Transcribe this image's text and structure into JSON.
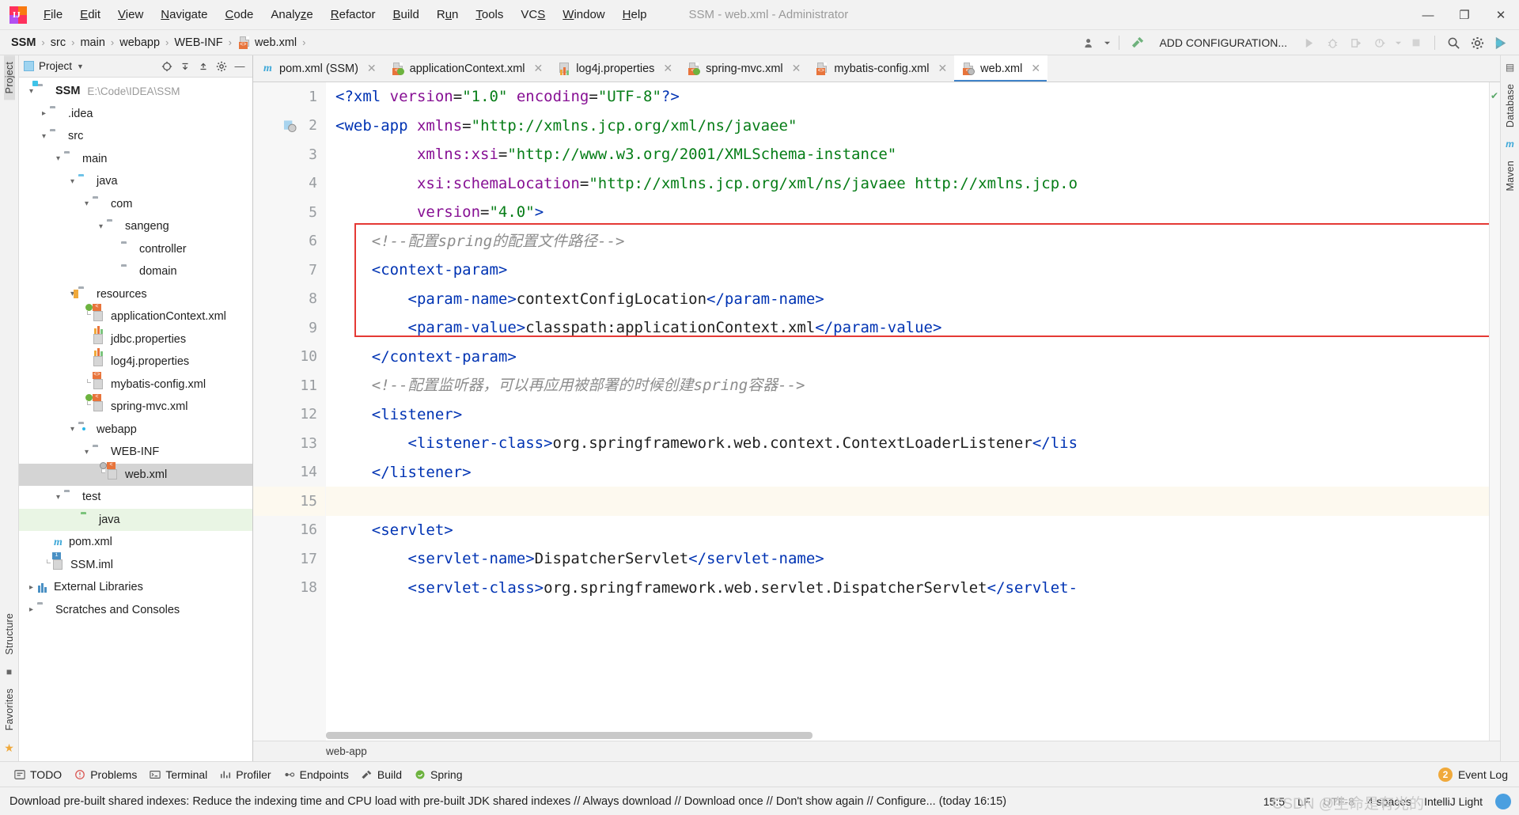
{
  "window": {
    "title": "SSM - web.xml - Administrator",
    "minimize": "—",
    "maximize": "❐",
    "close": "✕"
  },
  "menubar": {
    "items": [
      {
        "label": "File",
        "mnemonic": "F"
      },
      {
        "label": "Edit",
        "mnemonic": "E"
      },
      {
        "label": "View",
        "mnemonic": "V"
      },
      {
        "label": "Navigate",
        "mnemonic": "N"
      },
      {
        "label": "Code",
        "mnemonic": "C"
      },
      {
        "label": "Analyze",
        "mnemonic": "z"
      },
      {
        "label": "Refactor",
        "mnemonic": "R"
      },
      {
        "label": "Build",
        "mnemonic": "B"
      },
      {
        "label": "Run",
        "mnemonic": "u"
      },
      {
        "label": "Tools",
        "mnemonic": "T"
      },
      {
        "label": "VCS",
        "mnemonic": "S"
      },
      {
        "label": "Window",
        "mnemonic": "W"
      },
      {
        "label": "Help",
        "mnemonic": "H"
      }
    ]
  },
  "navbar": {
    "breadcrumbs": [
      "SSM",
      "src",
      "main",
      "webapp",
      "WEB-INF",
      "web.xml"
    ],
    "separator": "›",
    "add_configuration": "ADD CONFIGURATION...",
    "icons": [
      "account-icon",
      "chevron-down-icon",
      "build-hammer-icon",
      "run-icon",
      "debug-icon",
      "coverage-icon",
      "profile-icon",
      "chevron-down-icon",
      "stop-icon",
      "search-icon",
      "gear-icon",
      "ide-assistant-icon"
    ]
  },
  "left_rail": {
    "items": [
      "Project",
      "Structure",
      "Favorites"
    ]
  },
  "right_rail": {
    "items": [
      "Database",
      "Maven"
    ]
  },
  "project_panel": {
    "title": "Project",
    "actions": [
      "locate-icon",
      "collapse-all-icon",
      "expand-all-icon",
      "settings-icon",
      "hide-icon"
    ],
    "tree": [
      {
        "label": "SSM",
        "path": "E:\\Code\\IDEA\\SSM",
        "indent": 0,
        "arrow": "v",
        "icon": "module-folder",
        "bold": true,
        "state": "normal"
      },
      {
        "label": ".idea",
        "path": "",
        "indent": 1,
        "arrow": ">",
        "icon": "folder",
        "bold": false,
        "state": "normal"
      },
      {
        "label": "src",
        "path": "",
        "indent": 1,
        "arrow": "v",
        "icon": "folder",
        "bold": false,
        "state": "normal"
      },
      {
        "label": "main",
        "path": "",
        "indent": 2,
        "arrow": "v",
        "icon": "folder",
        "bold": false,
        "state": "normal"
      },
      {
        "label": "java",
        "path": "",
        "indent": 3,
        "arrow": "v",
        "icon": "source-folder",
        "bold": false,
        "state": "normal"
      },
      {
        "label": "com",
        "path": "",
        "indent": 4,
        "arrow": "v",
        "icon": "package",
        "bold": false,
        "state": "normal"
      },
      {
        "label": "sangeng",
        "path": "",
        "indent": 5,
        "arrow": "v",
        "icon": "package",
        "bold": false,
        "state": "normal"
      },
      {
        "label": "controller",
        "path": "",
        "indent": 6,
        "arrow": "",
        "icon": "package",
        "bold": false,
        "state": "normal"
      },
      {
        "label": "domain",
        "path": "",
        "indent": 6,
        "arrow": "",
        "icon": "package",
        "bold": false,
        "state": "normal"
      },
      {
        "label": "resources",
        "path": "",
        "indent": 3,
        "arrow": "v",
        "icon": "resource-folder",
        "bold": false,
        "state": "normal"
      },
      {
        "label": "applicationContext.xml",
        "path": "",
        "indent": 4,
        "arrow": "",
        "icon": "spring-xml",
        "bold": false,
        "state": "normal"
      },
      {
        "label": "jdbc.properties",
        "path": "",
        "indent": 4,
        "arrow": "",
        "icon": "properties",
        "bold": false,
        "state": "normal"
      },
      {
        "label": "log4j.properties",
        "path": "",
        "indent": 4,
        "arrow": "",
        "icon": "properties",
        "bold": false,
        "state": "normal"
      },
      {
        "label": "mybatis-config.xml",
        "path": "",
        "indent": 4,
        "arrow": "",
        "icon": "xml",
        "bold": false,
        "state": "normal"
      },
      {
        "label": "spring-mvc.xml",
        "path": "",
        "indent": 4,
        "arrow": "",
        "icon": "spring-xml",
        "bold": false,
        "state": "normal"
      },
      {
        "label": "webapp",
        "path": "",
        "indent": 3,
        "arrow": "v",
        "icon": "web-folder",
        "bold": false,
        "state": "normal"
      },
      {
        "label": "WEB-INF",
        "path": "",
        "indent": 4,
        "arrow": "v",
        "icon": "folder",
        "bold": false,
        "state": "normal"
      },
      {
        "label": "web.xml",
        "path": "",
        "indent": 5,
        "arrow": "",
        "icon": "web-xml",
        "bold": false,
        "state": "selected"
      },
      {
        "label": "test",
        "path": "",
        "indent": 2,
        "arrow": "v",
        "icon": "folder",
        "bold": false,
        "state": "normal"
      },
      {
        "label": "java",
        "path": "",
        "indent": 3,
        "arrow": "",
        "icon": "test-source-folder",
        "bold": false,
        "state": "highlighted"
      },
      {
        "label": "pom.xml",
        "path": "",
        "indent": 1,
        "arrow": "",
        "icon": "maven",
        "bold": false,
        "state": "normal"
      },
      {
        "label": "SSM.iml",
        "path": "",
        "indent": 1,
        "arrow": "",
        "icon": "iml",
        "bold": false,
        "state": "normal"
      },
      {
        "label": "External Libraries",
        "path": "",
        "indent": 0,
        "arrow": ">",
        "icon": "library",
        "bold": false,
        "state": "normal"
      },
      {
        "label": "Scratches and Consoles",
        "path": "",
        "indent": 0,
        "arrow": ">",
        "icon": "scratch",
        "bold": false,
        "state": "normal"
      }
    ]
  },
  "editor_tabs": [
    {
      "label": "pom.xml (SSM)",
      "icon": "maven-icon",
      "active": false,
      "close": "✕"
    },
    {
      "label": "applicationContext.xml",
      "icon": "spring-xml-icon",
      "active": false,
      "close": "✕"
    },
    {
      "label": "log4j.properties",
      "icon": "properties-icon",
      "active": false,
      "close": "✕"
    },
    {
      "label": "spring-mvc.xml",
      "icon": "spring-xml-icon",
      "active": false,
      "close": "✕"
    },
    {
      "label": "mybatis-config.xml",
      "icon": "xml-icon",
      "active": false,
      "close": "✕"
    },
    {
      "label": "web.xml",
      "icon": "web-xml-icon",
      "active": true,
      "close": "✕"
    }
  ],
  "editor": {
    "line_numbers": [
      "1",
      "2",
      "3",
      "4",
      "5",
      "6",
      "7",
      "8",
      "9",
      "10",
      "11",
      "12",
      "13",
      "14",
      "15",
      "16",
      "17",
      "18"
    ],
    "current_line": 15,
    "breadcrumb": "web-app",
    "lines": [
      {
        "n": 1,
        "tokens": [
          {
            "t": "<?",
            "c": "pi"
          },
          {
            "t": "xml",
            "c": "tag"
          },
          {
            "t": " ",
            "c": "txt"
          },
          {
            "t": "version",
            "c": "attr"
          },
          {
            "t": "=",
            "c": "txt"
          },
          {
            "t": "\"1.0\"",
            "c": "str"
          },
          {
            "t": " ",
            "c": "txt"
          },
          {
            "t": "encoding",
            "c": "attr"
          },
          {
            "t": "=",
            "c": "txt"
          },
          {
            "t": "\"UTF-8\"",
            "c": "str"
          },
          {
            "t": "?>",
            "c": "pi"
          }
        ]
      },
      {
        "n": 2,
        "tokens": [
          {
            "t": "<web-app",
            "c": "tag"
          },
          {
            "t": " ",
            "c": "txt"
          },
          {
            "t": "xmlns",
            "c": "attr"
          },
          {
            "t": "=",
            "c": "txt"
          },
          {
            "t": "\"http://xmlns.jcp.org/xml/ns/javaee\"",
            "c": "str"
          }
        ]
      },
      {
        "n": 3,
        "tokens": [
          {
            "t": "         ",
            "c": "txt"
          },
          {
            "t": "xmlns:xsi",
            "c": "attr"
          },
          {
            "t": "=",
            "c": "txt"
          },
          {
            "t": "\"http://www.w3.org/2001/XMLSchema-instance\"",
            "c": "str"
          }
        ]
      },
      {
        "n": 4,
        "tokens": [
          {
            "t": "         ",
            "c": "txt"
          },
          {
            "t": "xsi:schemaLocation",
            "c": "attr"
          },
          {
            "t": "=",
            "c": "txt"
          },
          {
            "t": "\"http://xmlns.jcp.org/xml/ns/javaee http://xmlns.jcp.o",
            "c": "str"
          }
        ]
      },
      {
        "n": 5,
        "tokens": [
          {
            "t": "         ",
            "c": "txt"
          },
          {
            "t": "version",
            "c": "attr"
          },
          {
            "t": "=",
            "c": "txt"
          },
          {
            "t": "\"4.0\"",
            "c": "str"
          },
          {
            "t": ">",
            "c": "tag"
          }
        ]
      },
      {
        "n": 6,
        "tokens": [
          {
            "t": "    <!--配置spring的配置文件路径-->",
            "c": "cmt"
          }
        ]
      },
      {
        "n": 7,
        "tokens": [
          {
            "t": "    ",
            "c": "txt"
          },
          {
            "t": "<context-param>",
            "c": "tag"
          }
        ]
      },
      {
        "n": 8,
        "tokens": [
          {
            "t": "        ",
            "c": "txt"
          },
          {
            "t": "<param-name>",
            "c": "tag"
          },
          {
            "t": "contextConfigLocation",
            "c": "txt"
          },
          {
            "t": "</param-name>",
            "c": "tag"
          }
        ]
      },
      {
        "n": 9,
        "tokens": [
          {
            "t": "        ",
            "c": "txt"
          },
          {
            "t": "<param-value>",
            "c": "tag"
          },
          {
            "t": "classpath:applicationContext.xml",
            "c": "txt"
          },
          {
            "t": "</param-value>",
            "c": "tag"
          }
        ]
      },
      {
        "n": 10,
        "tokens": [
          {
            "t": "    ",
            "c": "txt"
          },
          {
            "t": "</context-param>",
            "c": "tag"
          }
        ]
      },
      {
        "n": 11,
        "tokens": [
          {
            "t": "    <!--配置监听器，可以再应用被部署的时候创建spring容器-->",
            "c": "cmt"
          }
        ]
      },
      {
        "n": 12,
        "tokens": [
          {
            "t": "    ",
            "c": "txt"
          },
          {
            "t": "<listener>",
            "c": "tag"
          }
        ]
      },
      {
        "n": 13,
        "tokens": [
          {
            "t": "        ",
            "c": "txt"
          },
          {
            "t": "<listener-class>",
            "c": "tag"
          },
          {
            "t": "org.springframework.web.context.ContextLoaderListener",
            "c": "txt"
          },
          {
            "t": "</lis",
            "c": "tag"
          }
        ]
      },
      {
        "n": 14,
        "tokens": [
          {
            "t": "    ",
            "c": "txt"
          },
          {
            "t": "</listener>",
            "c": "tag"
          }
        ]
      },
      {
        "n": 15,
        "tokens": [
          {
            "t": "",
            "c": "txt"
          }
        ]
      },
      {
        "n": 16,
        "tokens": [
          {
            "t": "    ",
            "c": "txt"
          },
          {
            "t": "<servlet>",
            "c": "tag"
          }
        ]
      },
      {
        "n": 17,
        "tokens": [
          {
            "t": "        ",
            "c": "txt"
          },
          {
            "t": "<servlet-name>",
            "c": "tag"
          },
          {
            "t": "DispatcherServlet",
            "c": "txt"
          },
          {
            "t": "</servlet-name>",
            "c": "tag"
          }
        ]
      },
      {
        "n": 18,
        "tokens": [
          {
            "t": "        ",
            "c": "txt"
          },
          {
            "t": "<servlet-class>",
            "c": "tag"
          },
          {
            "t": "org.springframework.web.servlet.DispatcherServlet",
            "c": "txt"
          },
          {
            "t": "</servlet-",
            "c": "tag"
          }
        ]
      }
    ],
    "highlight_box_color": "#e53935"
  },
  "bottom_bar": {
    "items": [
      {
        "label": "TODO",
        "icon": "todo-icon"
      },
      {
        "label": "Problems",
        "icon": "problems-icon"
      },
      {
        "label": "Terminal",
        "icon": "terminal-icon"
      },
      {
        "label": "Profiler",
        "icon": "profiler-icon"
      },
      {
        "label": "Endpoints",
        "icon": "endpoints-icon"
      },
      {
        "label": "Build",
        "icon": "build-icon"
      },
      {
        "label": "Spring",
        "icon": "spring-icon"
      }
    ],
    "event_log": "Event Log",
    "event_count": "2"
  },
  "status_bar": {
    "message": "Download pre-built shared indexes: Reduce the indexing time and CPU load with pre-built JDK shared indexes // Always download // Download once // Don't show again // Configure... (today 16:15)",
    "caret": "15:5",
    "line_separator": "LF",
    "encoding": "UTF-8",
    "indent": "4 spaces",
    "branch": "IntelliJ Light",
    "watermark": "CSDN @生命是有光的"
  }
}
